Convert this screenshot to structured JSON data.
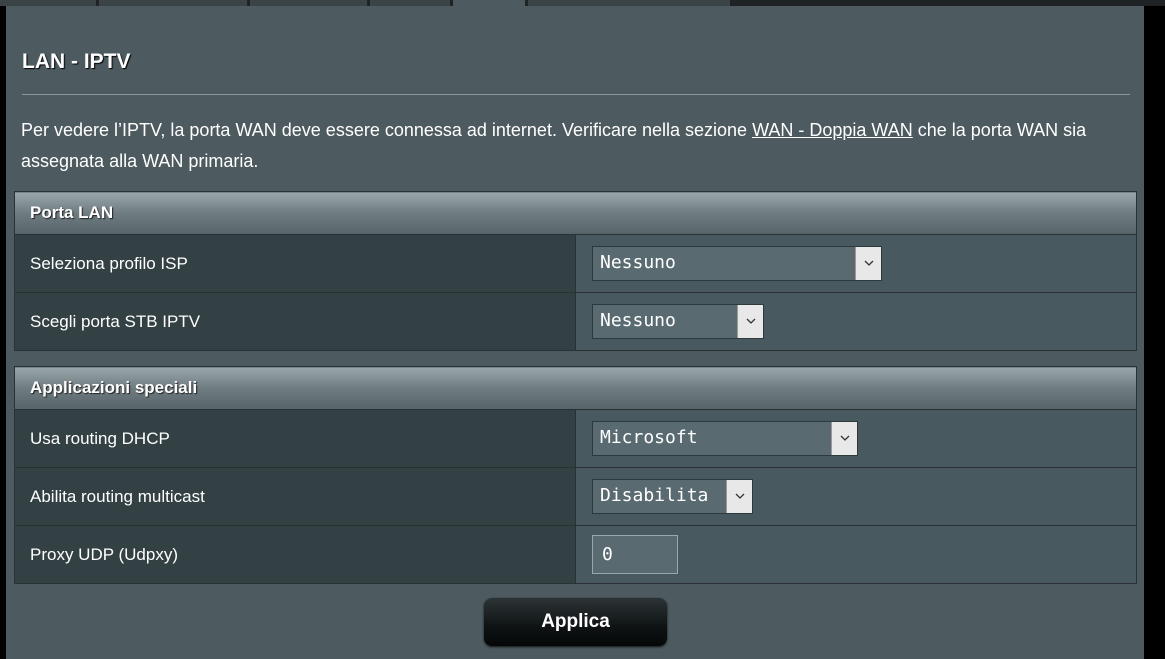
{
  "page": {
    "title": "LAN - IPTV",
    "description_before_link": "Per vedere l’IPTV, la porta WAN deve essere connessa ad internet. Verificare nella sezione ",
    "description_link": "WAN - Doppia WAN",
    "description_after_link": " che la porta WAN sia assegnata alla WAN primaria."
  },
  "lan_port": {
    "header": "Porta LAN",
    "isp_profile": {
      "label": "Seleziona profilo ISP",
      "value": "Nessuno"
    },
    "stb_port": {
      "label": "Scegli porta STB IPTV",
      "value": "Nessuno"
    }
  },
  "special_apps": {
    "header": "Applicazioni speciali",
    "dhcp_routing": {
      "label": "Usa routing DHCP",
      "value": "Microsoft"
    },
    "multicast_routing": {
      "label": "Abilita routing multicast",
      "value": "Disabilita"
    },
    "udp_proxy": {
      "label": "Proxy UDP (Udpxy)",
      "value": "0"
    }
  },
  "actions": {
    "apply_label": "Applica"
  },
  "icons": {
    "dropdown": "chevron-down-icon"
  },
  "colors": {
    "panel_background": "#4d5a5f",
    "label_cell": "#334044",
    "value_cell": "#485a60",
    "apply_button": "#0f1314"
  }
}
